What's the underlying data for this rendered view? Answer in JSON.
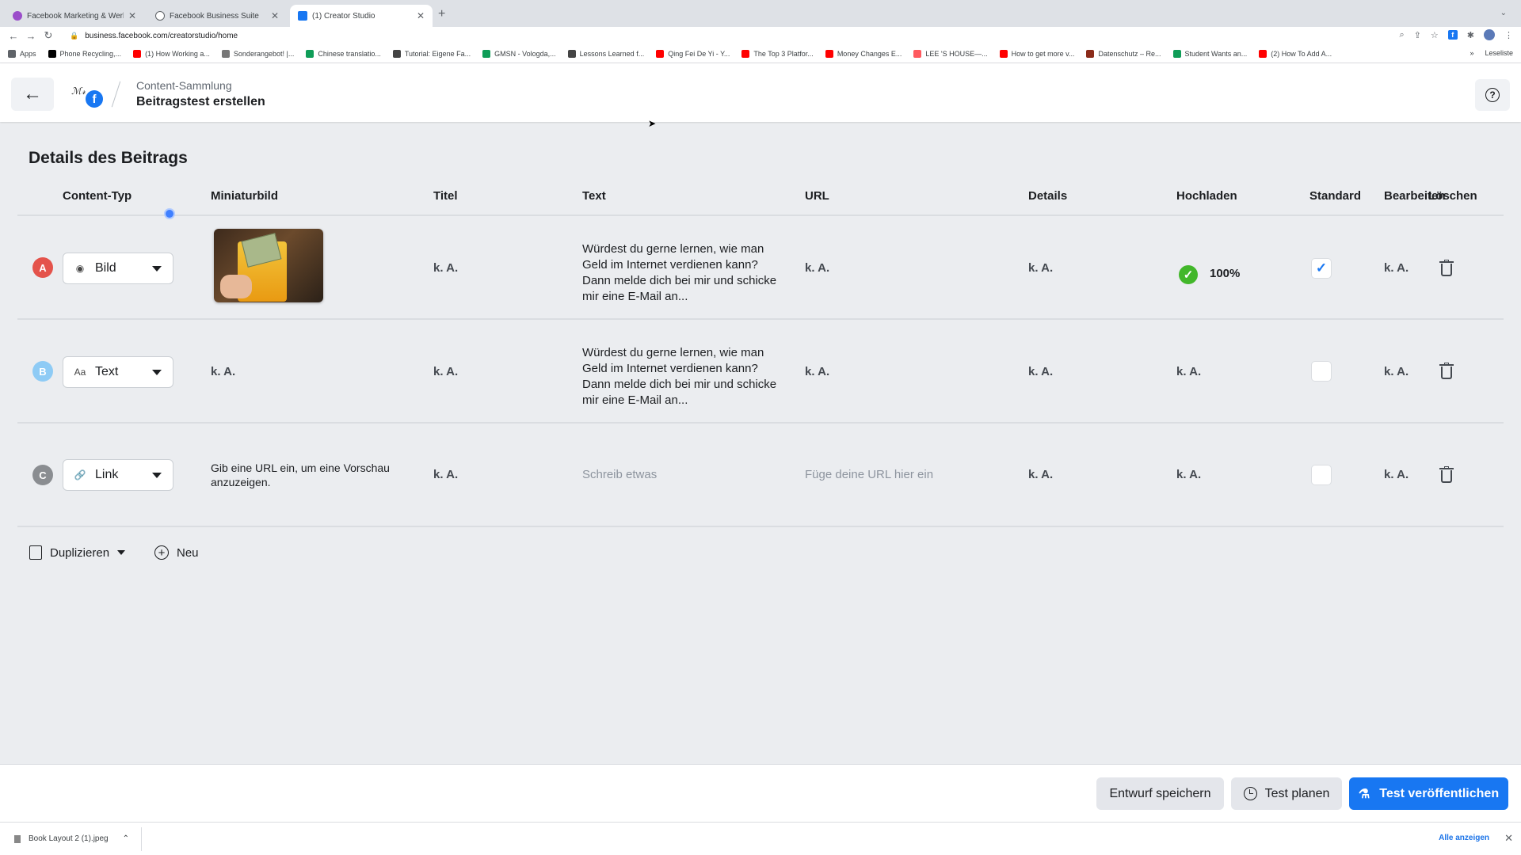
{
  "browser": {
    "tabs": [
      {
        "title": "Facebook Marketing & Werbe",
        "color": "#9b4dca",
        "active": false
      },
      {
        "title": "Facebook Business Suite",
        "color": "#5f6368",
        "active": false
      },
      {
        "title": "(1) Creator Studio",
        "color": "#1877f2",
        "active": true
      }
    ],
    "url": "business.facebook.com/creatorstudio/home",
    "bookmarks": [
      {
        "label": "Apps",
        "color": "#5f6368"
      },
      {
        "label": "Phone Recycling,...",
        "color": "#000000"
      },
      {
        "label": "(1) How Working a...",
        "color": "#ff0000"
      },
      {
        "label": "Sonderangebot! |...",
        "color": "#777777"
      },
      {
        "label": "Chinese translatio...",
        "color": "#0f9d58"
      },
      {
        "label": "Tutorial: Eigene Fa...",
        "color": "#444444"
      },
      {
        "label": "GMSN - Vologda,...",
        "color": "#0f9d58"
      },
      {
        "label": "Lessons Learned f...",
        "color": "#444444"
      },
      {
        "label": "Qing Fei De Yi - Y...",
        "color": "#ff0000"
      },
      {
        "label": "The Top 3 Platfor...",
        "color": "#ff0000"
      },
      {
        "label": "Money Changes E...",
        "color": "#ff0000"
      },
      {
        "label": "LEE 'S HOUSE—...",
        "color": "#ff5a5f"
      },
      {
        "label": "How to get more v...",
        "color": "#ff0000"
      },
      {
        "label": "Datenschutz – Re...",
        "color": "#8b2b1a"
      },
      {
        "label": "Student Wants an...",
        "color": "#0f9d58"
      },
      {
        "label": "(2) How To Add A...",
        "color": "#ff0000"
      }
    ],
    "bookmarks_more": "»",
    "reading_list": "Leseliste"
  },
  "header": {
    "breadcrumb": "Content-Sammlung",
    "title": "Beitragstest erstellen"
  },
  "section": {
    "title": "Details des Beitrags",
    "columns": [
      "Content-Typ",
      "Miniaturbild",
      "Titel",
      "Text",
      "URL",
      "Details",
      "Hochladen",
      "Standard",
      "Bearbeiten",
      "Löschen"
    ]
  },
  "rows": [
    {
      "badge": "A",
      "badge_color": "#e4534b",
      "type": "Bild",
      "type_icon": "image-icon",
      "thumbnail": "photo",
      "title": "k. A.",
      "text": "Würdest du gerne lernen, wie man Geld im Internet verdienen kann? Dann melde dich bei mir und schicke mir eine E-Mail an...",
      "url": "k. A.",
      "details": "k. A.",
      "upload": "100%",
      "standard": true,
      "edit": "k. A."
    },
    {
      "badge": "B",
      "badge_color": "#8ecbf5",
      "type": "Text",
      "type_icon": "text-format-icon",
      "thumbnail": "k. A.",
      "title": "k. A.",
      "text": "Würdest du gerne lernen, wie man Geld im Internet verdienen kann? Dann melde dich bei mir und schicke mir eine E-Mail an...",
      "url": "k. A.",
      "details": "k. A.",
      "upload": "k. A.",
      "standard": false,
      "edit": "k. A."
    },
    {
      "badge": "C",
      "badge_color": "#8a8d91",
      "type": "Link",
      "type_icon": "link-icon",
      "thumbnail": "Gib eine URL ein, um eine Vorschau anzuzeigen.",
      "title": "k. A.",
      "text_placeholder": "Schreib etwas",
      "url_placeholder": "Füge deine URL hier ein",
      "details": "k. A.",
      "upload": "k. A.",
      "standard": false,
      "edit": "k. A."
    }
  ],
  "actions": {
    "duplicate": "Duplizieren",
    "new": "Neu"
  },
  "footer": {
    "save_draft": "Entwurf speichern",
    "schedule": "Test planen",
    "publish": "Test veröffentlichen"
  },
  "download_shelf": {
    "file": "Book Layout 2 (1).jpeg",
    "show_all": "Alle anzeigen"
  },
  "colors": {
    "accent": "#1877f2",
    "success": "#42b72a",
    "background": "#ebedf0"
  }
}
